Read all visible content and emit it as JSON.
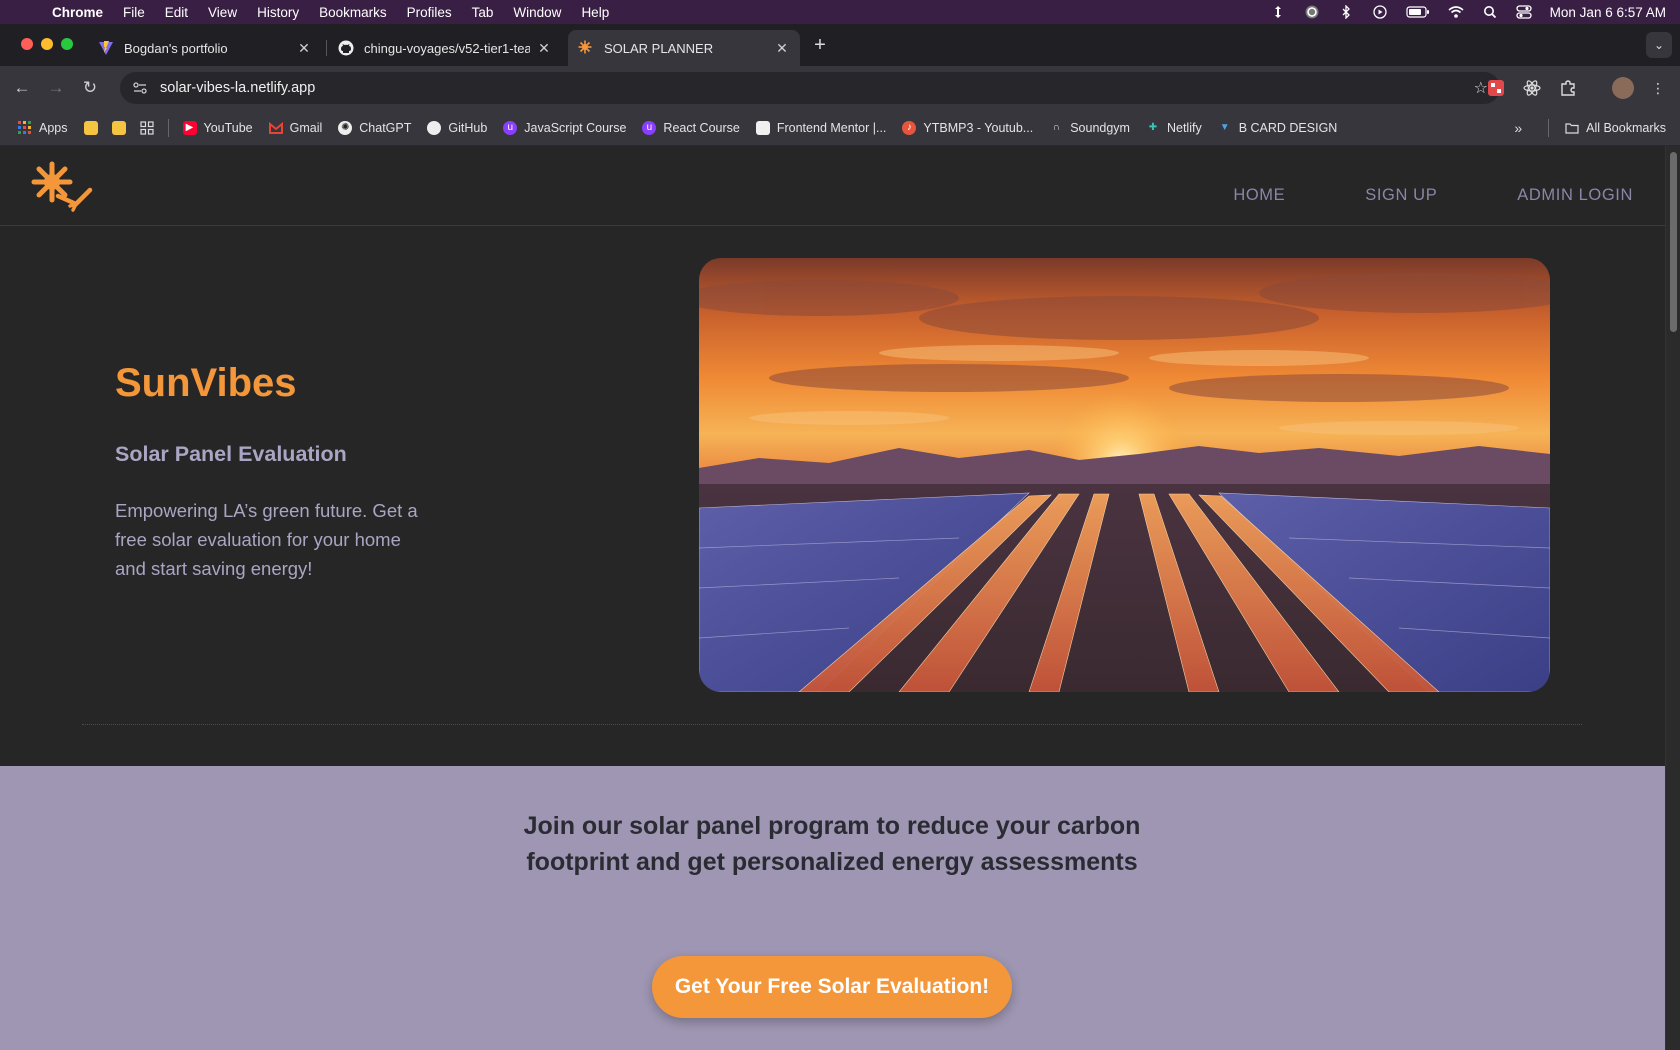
{
  "menubar": {
    "app": "Chrome",
    "items": [
      "File",
      "Edit",
      "View",
      "History",
      "Bookmarks",
      "Profiles",
      "Tab",
      "Window",
      "Help"
    ],
    "clock": "Mon Jan 6  6:57 AM"
  },
  "tabs": [
    {
      "title": "Bogdan's portfolio",
      "icon": "vite-icon"
    },
    {
      "title": "chingu-voyages/v52-tier1-tea",
      "icon": "github-icon"
    },
    {
      "title": "SOLAR PLANNER",
      "icon": "sun-icon",
      "active": true
    }
  ],
  "toolbar": {
    "url": "solar-vibes-la.netlify.app"
  },
  "bookmarks": {
    "apps": "Apps",
    "items": [
      "YouTube",
      "Gmail",
      "ChatGPT",
      "GitHub",
      "JavaScript Course",
      "React Course",
      "Frontend Mentor |...",
      "YTBMP3 - Youtub...",
      "Soundgym",
      "Netlify",
      "B CARD DESIGN"
    ],
    "all": "All Bookmarks"
  },
  "site": {
    "nav": [
      "HOME",
      "SIGN UP",
      "ADMIN LOGIN"
    ],
    "hero": {
      "title": "SunVibes",
      "subtitle": "Solar Panel Evaluation",
      "description": "Empowering LA’s green future. Get a free solar evaluation for your home and start saving energy!"
    },
    "cta": {
      "text": "Join our solar panel program to reduce your carbon footprint and get personalized energy assessments",
      "button": "Get Your Free Solar Evaluation!"
    }
  },
  "colors": {
    "accent": "#f4973a",
    "nav_text": "#8a86a8",
    "cta_bg": "#9e96b2",
    "page_bg": "#262626"
  }
}
